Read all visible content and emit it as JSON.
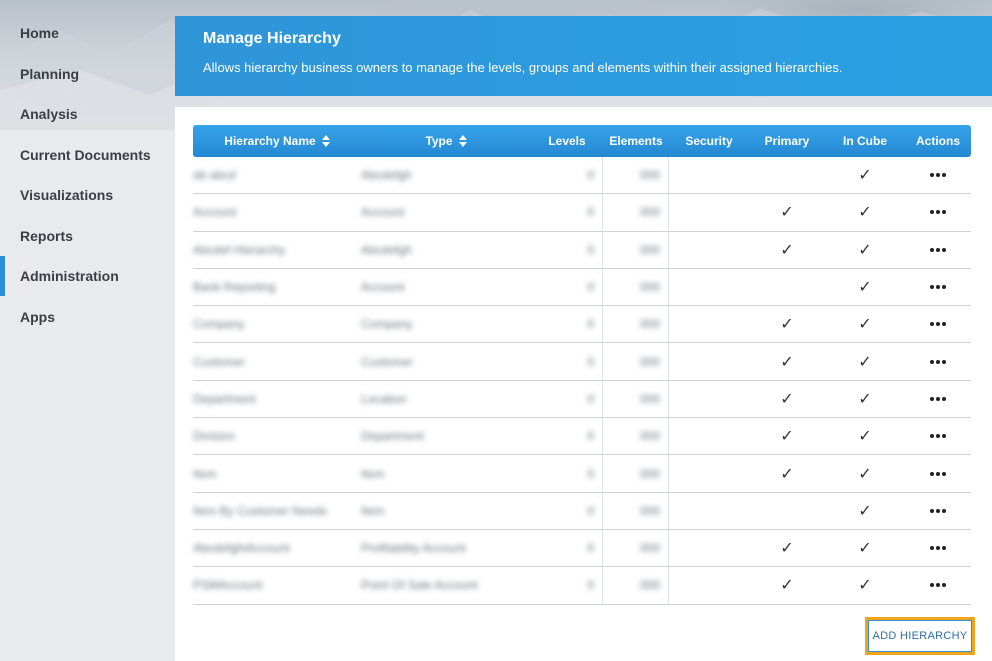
{
  "sidebar": {
    "items": [
      {
        "label": "Home",
        "active": false
      },
      {
        "label": "Planning",
        "active": false
      },
      {
        "label": "Analysis",
        "active": false
      },
      {
        "label": "Current Documents",
        "active": false
      },
      {
        "label": "Visualizations",
        "active": false
      },
      {
        "label": "Reports",
        "active": false
      },
      {
        "label": "Administration",
        "active": true
      },
      {
        "label": "Apps",
        "active": false
      }
    ]
  },
  "header": {
    "title": "Manage Hierarchy",
    "description": "Allows hierarchy business owners to manage the levels, groups and elements within their assigned hierarchies."
  },
  "table": {
    "columns": [
      "Hierarchy Name",
      "Type",
      "Levels",
      "Elements",
      "Security",
      "Primary",
      "In Cube",
      "Actions"
    ],
    "rows": [
      {
        "name": "(redacted)",
        "type": "(redacted)",
        "levels": "",
        "elements": "",
        "primary": false,
        "in_cube": true
      },
      {
        "name": "(redacted)",
        "type": "(redacted)",
        "levels": "",
        "elements": "",
        "primary": true,
        "in_cube": true
      },
      {
        "name": "(redacted)",
        "type": "(redacted)",
        "levels": "",
        "elements": "",
        "primary": true,
        "in_cube": true
      },
      {
        "name": "(redacted)",
        "type": "(redacted)",
        "levels": "",
        "elements": "",
        "primary": false,
        "in_cube": true
      },
      {
        "name": "(redacted)",
        "type": "(redacted)",
        "levels": "",
        "elements": "",
        "primary": true,
        "in_cube": true
      },
      {
        "name": "(redacted)",
        "type": "(redacted)",
        "levels": "",
        "elements": "",
        "primary": true,
        "in_cube": true
      },
      {
        "name": "(redacted)",
        "type": "(redacted)",
        "levels": "",
        "elements": "",
        "primary": true,
        "in_cube": true
      },
      {
        "name": "(redacted)",
        "type": "(redacted)",
        "levels": "",
        "elements": "",
        "primary": true,
        "in_cube": true
      },
      {
        "name": "(redacted)",
        "type": "(redacted)",
        "levels": "",
        "elements": "",
        "primary": true,
        "in_cube": true
      },
      {
        "name": "(redacted)",
        "type": "(redacted)",
        "levels": "",
        "elements": "",
        "primary": false,
        "in_cube": true
      },
      {
        "name": "(redacted)",
        "type": "(redacted)",
        "levels": "",
        "elements": "",
        "primary": true,
        "in_cube": true
      },
      {
        "name": "(redacted)",
        "type": "(redacted)",
        "levels": "",
        "elements": "",
        "primary": true,
        "in_cube": true
      }
    ],
    "check_glyph": "✓"
  },
  "actions": {
    "add_label": "ADD HIERARCHY"
  },
  "colors": {
    "accent": "#2a8fd6",
    "highlight": "#f2a51a"
  }
}
